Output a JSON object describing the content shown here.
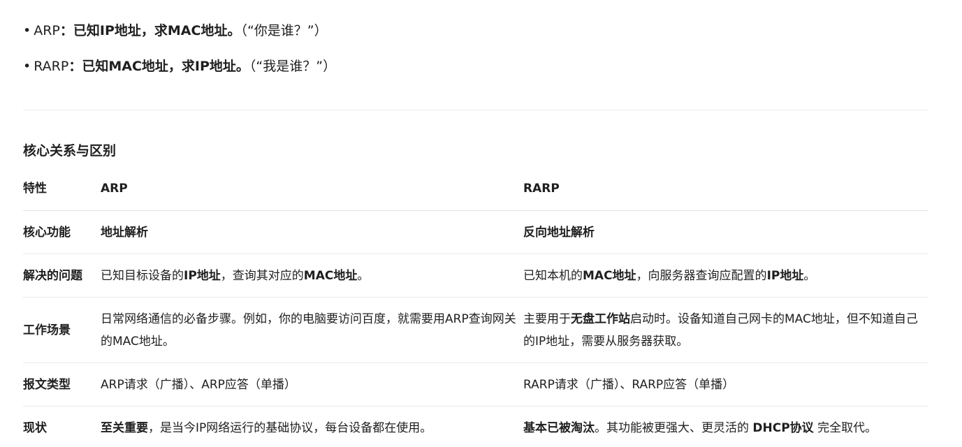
{
  "bullets": [
    {
      "dot": "•",
      "name": "ARP",
      "colon": "：",
      "bold": "已知IP地址，求MAC地址。",
      "note": "（“你是谁？”）"
    },
    {
      "dot": "•",
      "name": "RARP",
      "colon": "：",
      "bold": "已知MAC地址，求IP地址。",
      "note": "（“我是谁？”）"
    }
  ],
  "section_title": "核心关系与区别",
  "table": {
    "headers": [
      "特性",
      "ARP",
      "RARP"
    ],
    "rows": {
      "core": {
        "label": "核心功能",
        "arp": "地址解析",
        "rarp": "反向地址解析"
      },
      "problem": {
        "label": "解决的问题",
        "arp_a": "已知目标设备的",
        "arp_b": "IP地址",
        "arp_c": "，查询其对应的",
        "arp_d": "MAC地址",
        "arp_e": "。",
        "rarp_a": "已知本机的",
        "rarp_b": "MAC地址",
        "rarp_c": "，向服务器查询应配置的",
        "rarp_d": "IP地址",
        "rarp_e": "。"
      },
      "scene": {
        "label": "工作场景",
        "arp": "日常网络通信的必备步骤。例如，你的电脑要访问百度，就需要用ARP查询网关的MAC地址。",
        "rarp_a": "主要用于",
        "rarp_b": "无盘工作站",
        "rarp_c": "启动时。设备知道自己网卡的MAC地址，但不知道自己的IP地址，需要从服务器获取。"
      },
      "msg": {
        "label": "报文类型",
        "arp": "ARP请求（广播）、ARP应答（单播）",
        "rarp": "RARP请求（广播）、RARP应答（单播）"
      },
      "status": {
        "label": "现状",
        "arp_a": "至关重要",
        "arp_b": "，是当今IP网络运行的基础协议，每台设备都在使用。",
        "rarp_a": "基本已被淘汰",
        "rarp_b": "。其功能被更强大、更灵活的 ",
        "rarp_c": "DHCP协议",
        "rarp_d": " 完全取代。"
      }
    }
  }
}
